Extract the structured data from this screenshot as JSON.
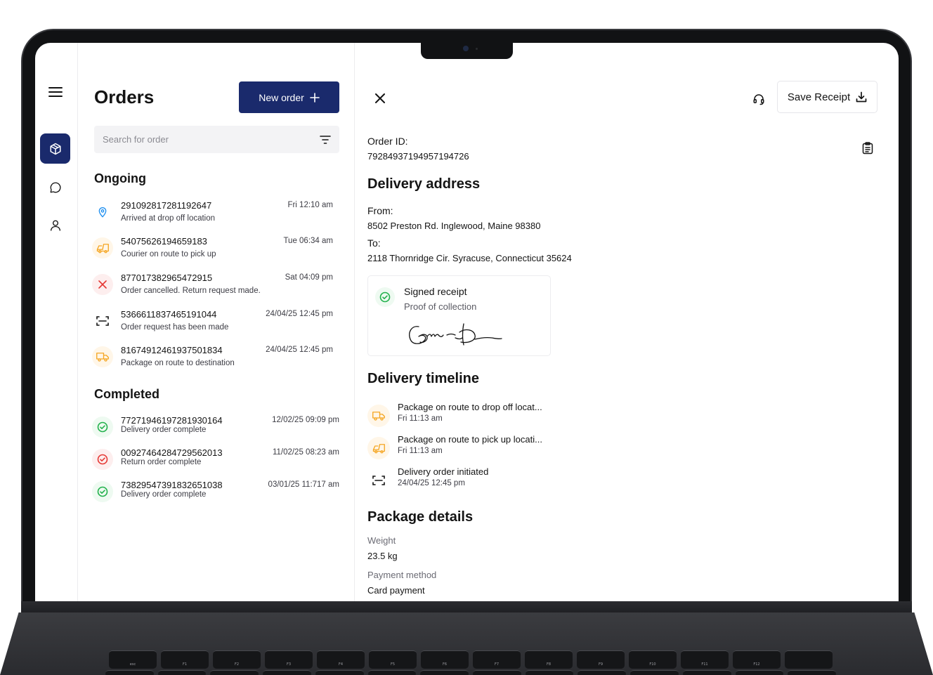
{
  "nav": {
    "items": [
      {
        "name": "menu",
        "icon": "hamburger-icon"
      },
      {
        "name": "orders",
        "icon": "package-icon",
        "active": true
      },
      {
        "name": "messages",
        "icon": "chat-icon"
      },
      {
        "name": "profile",
        "icon": "user-icon"
      }
    ]
  },
  "orders_panel": {
    "title": "Orders",
    "new_order_label": "New order",
    "search_placeholder": "Search for order",
    "ongoing_title": "Ongoing",
    "completed_title": "Completed",
    "ongoing": [
      {
        "id": "291092817281192647",
        "status": "Arrived at drop off location",
        "time": "Fri 12:10 am",
        "icon": "location-pin-icon",
        "color": "#1e8ff0"
      },
      {
        "id": "54075626194659183",
        "status": "Courier on route to pick up",
        "time": "Tue 06:34 am",
        "icon": "truck-icon",
        "color": "#f5a623"
      },
      {
        "id": "877017382965472915",
        "status": "Order cancelled. Return request made.",
        "time": "Sat 04:09 pm",
        "icon": "cancel-icon",
        "color": "#e53935"
      },
      {
        "id": "5366611837465191044",
        "status": "Order request has been made",
        "time": "24/04/25 12:45 pm",
        "icon": "scan-icon",
        "color": "#141414"
      },
      {
        "id": "816749124619375018 34",
        "status": "Package on route to destination",
        "time": "24/04/25 12:45 pm",
        "icon": "delivery-truck-icon",
        "color": "#f5a623"
      }
    ],
    "completed": [
      {
        "id": "77271946197281930164",
        "status": "Delivery order complete",
        "time": "12/02/25 09:09 pm",
        "icon": "check-circle-icon",
        "color": "#22b14c"
      },
      {
        "id": "00927464284729562013",
        "status": "Return order complete",
        "time": "11/02/25 08:23 am",
        "icon": "check-circle-icon",
        "color": "#e53935"
      },
      {
        "id": "73829547391832651038",
        "status": "Delivery order complete",
        "time": "03/01/25 11:717 am",
        "icon": "check-circle-icon",
        "color": "#22b14c"
      }
    ]
  },
  "detail": {
    "save_receipt_label": "Save Receipt",
    "order_id_label": "Order ID:",
    "order_id": "79284937194957194726",
    "delivery_address_title": "Delivery address",
    "from_label": "From:",
    "from_address": "8502 Preston Rd. Inglewood, Maine 98380",
    "to_label": "To:",
    "to_address": "2118 Thornridge Cir. Syracuse, Connecticut 35624",
    "receipt": {
      "title": "Signed receipt",
      "subtitle": "Proof of collection"
    },
    "timeline_title": "Delivery timeline",
    "timeline": [
      {
        "title": "Package on route to drop off locat...",
        "time": "Fri 11:13 am",
        "icon": "delivery-truck-icon",
        "color": "#f5a623"
      },
      {
        "title": "Package on route to pick up locati...",
        "time": "Fri 11:13 am",
        "icon": "truck-icon",
        "color": "#f5a623"
      },
      {
        "title": "Delivery order initiated",
        "time": "24/04/25 12:45 pm",
        "icon": "scan-icon",
        "color": "#141414"
      }
    ],
    "package_title": "Package details",
    "weight_label": "Weight",
    "weight_value": "23.5 kg",
    "payment_label": "Payment method",
    "payment_value": "Card payment"
  },
  "keyboard": {
    "fn_keys": [
      "esc",
      "F1",
      "F2",
      "F3",
      "F4",
      "F5",
      "F6",
      "F7",
      "F8",
      "F9",
      "F10",
      "F11",
      "F12",
      ""
    ]
  },
  "colors": {
    "brand": "#1a2a6c",
    "warning": "#f5a623",
    "success": "#22b14c",
    "danger": "#e53935",
    "info": "#1e8ff0"
  }
}
